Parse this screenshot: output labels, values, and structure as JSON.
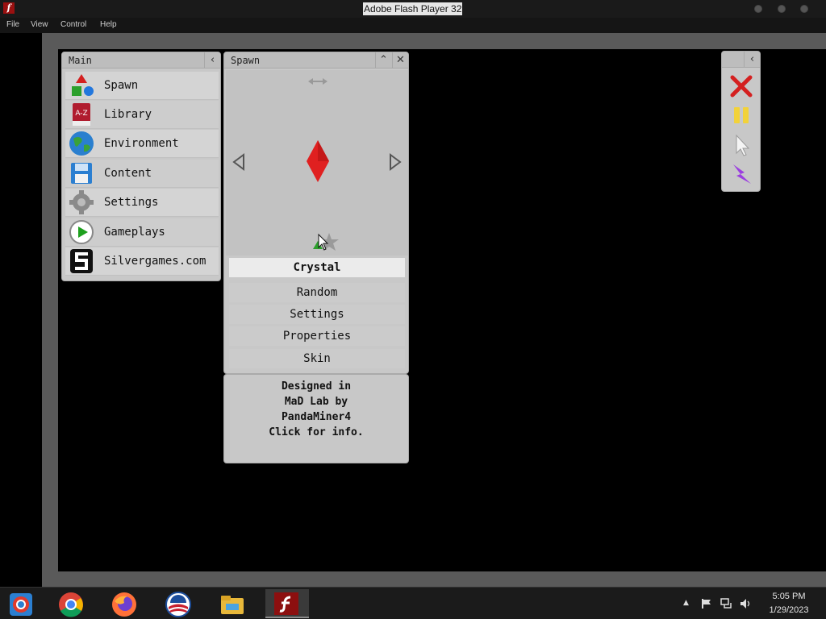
{
  "window": {
    "title": "Adobe Flash Player 32"
  },
  "menu": [
    "File",
    "View",
    "Control",
    "Help"
  ],
  "main_panel": {
    "title": "Main",
    "collapse_glyph": "‹",
    "items": [
      {
        "label": "Spawn",
        "icon": "shapes-icon"
      },
      {
        "label": "Library",
        "icon": "book-icon",
        "icon_text": "A-Z"
      },
      {
        "label": "Environment",
        "icon": "globe-icon"
      },
      {
        "label": "Content",
        "icon": "floppy-disk-icon"
      },
      {
        "label": "Settings",
        "icon": "gear-icon"
      },
      {
        "label": "Gameplays",
        "icon": "play-icon"
      },
      {
        "label": "Silvergames.com",
        "icon": "silvergames-logo-icon"
      }
    ]
  },
  "spawn_panel": {
    "title": "Spawn",
    "selected": "Crystal",
    "buttons": [
      "Random",
      "Settings",
      "Properties",
      "Skin"
    ],
    "colors": {
      "crystal": "#e02020"
    }
  },
  "info": {
    "lines": [
      "Designed in",
      "MaD Lab by",
      "PandaMiner4",
      "Click for info."
    ]
  },
  "tools": [
    "close-icon",
    "pause-icon",
    "pointer-icon",
    "lightning-icon"
  ],
  "taskbar": {
    "apps": [
      "chrome-remote-icon",
      "chrome-icon",
      "firefox-icon",
      "obama-icon",
      "file-explorer-icon",
      "flash-player-icon"
    ],
    "time": "5:05 PM",
    "date": "1/29/2023"
  }
}
